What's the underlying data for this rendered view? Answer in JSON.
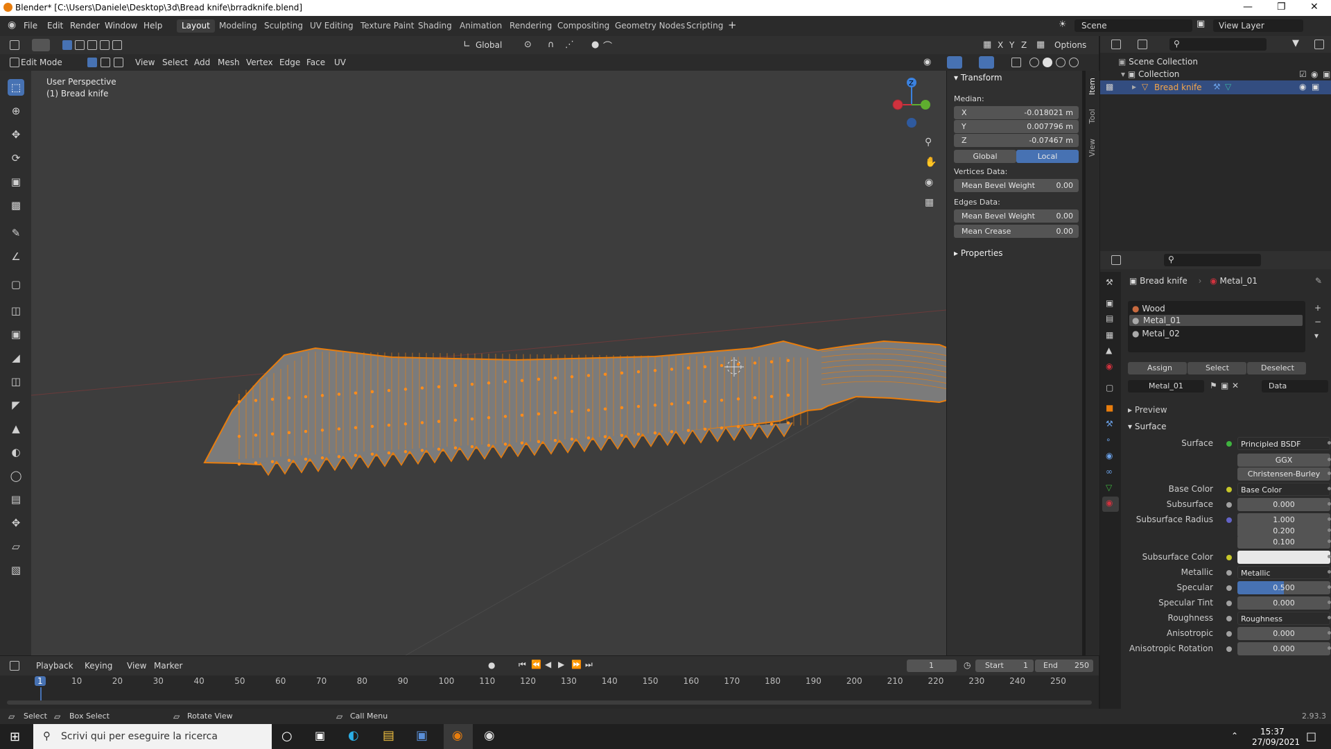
{
  "window": {
    "title": "Blender* [C:\\Users\\Daniele\\Desktop\\3d\\Bread knife\\brradknife.blend]"
  },
  "menu": {
    "items": [
      "File",
      "Edit",
      "Render",
      "Window",
      "Help"
    ]
  },
  "workspaces": [
    "Layout",
    "Modeling",
    "Sculpting",
    "UV Editing",
    "Texture Paint",
    "Shading",
    "Animation",
    "Rendering",
    "Compositing",
    "Geometry Nodes",
    "Scripting"
  ],
  "scene": {
    "label": "Scene",
    "view_layer": "View Layer"
  },
  "toolheader": {
    "transform_orientation": "Global",
    "options": "Options",
    "axes": [
      "X",
      "Y",
      "Z"
    ]
  },
  "viewport_header": {
    "mode": "Edit Mode",
    "menus": [
      "View",
      "Select",
      "Add",
      "Mesh",
      "Vertex",
      "Edge",
      "Face",
      "UV"
    ]
  },
  "viewport": {
    "perspective": "User Perspective",
    "object": "(1) Bread knife",
    "gizmo": {
      "x": "X",
      "y": "Y",
      "z": "Z"
    }
  },
  "npanel": {
    "tabs": [
      "Item",
      "Tool",
      "View"
    ],
    "transform_title": "Transform",
    "median_label": "Median:",
    "x_label": "X",
    "x": "-0.018021 m",
    "y_label": "Y",
    "y": "0.007796 m",
    "z_label": "Z",
    "z": "-0.07467 m",
    "global": "Global",
    "local": "Local",
    "vertices_data": "Vertices Data:",
    "mean_bevel_weight": "Mean Bevel Weight",
    "vbw": "0.00",
    "edges_data": "Edges Data:",
    "ebw": "0.00",
    "mean_crease": "Mean Crease",
    "crease": "0.00",
    "properties": "Properties"
  },
  "outliner": {
    "scene_collection": "Scene Collection",
    "collection": "Collection",
    "object": "Bread knife"
  },
  "properties": {
    "object": "Bread knife",
    "material": "Metal_01",
    "slots": [
      "Wood",
      "Metal_01",
      "Metal_02"
    ],
    "assign": "Assign",
    "select": "Select",
    "deselect": "Deselect",
    "mat_name": "Metal_01",
    "data": "Data",
    "preview": "Preview",
    "surface_section": "Surface",
    "rows": [
      {
        "label": "Surface",
        "value": "Principled BSDF",
        "dot": "#3fb33f",
        "link": true
      },
      {
        "label": "",
        "value": "GGX",
        "dot": "",
        "link": false
      },
      {
        "label": "",
        "value": "Christensen-Burley",
        "dot": "",
        "link": false
      },
      {
        "label": "Base Color",
        "value": "Base Color",
        "dot": "#c7c729",
        "link": true
      },
      {
        "label": "Subsurface",
        "value": "0.000",
        "dot": "#a1a1a1",
        "link": false
      },
      {
        "label": "Subsurface Radius",
        "value": "1.000",
        "dot": "#6363c7",
        "link": false
      },
      {
        "label": "",
        "value": "0.200",
        "dot": "",
        "link": false
      },
      {
        "label": "",
        "value": "0.100",
        "dot": "",
        "link": false
      },
      {
        "label": "Subsurface Color",
        "value": "",
        "dot": "#c7c729",
        "link": false
      },
      {
        "label": "Metallic",
        "value": "Metallic",
        "dot": "#a1a1a1",
        "link": true
      },
      {
        "label": "Specular",
        "value": "0.500",
        "dot": "#a1a1a1",
        "link": false
      },
      {
        "label": "Specular Tint",
        "value": "0.000",
        "dot": "#a1a1a1",
        "link": false
      },
      {
        "label": "Roughness",
        "value": "Roughness",
        "dot": "#a1a1a1",
        "link": true
      },
      {
        "label": "Anisotropic",
        "value": "0.000",
        "dot": "#a1a1a1",
        "link": false
      },
      {
        "label": "Anisotropic Rotation",
        "value": "0.000",
        "dot": "#a1a1a1",
        "link": false
      }
    ],
    "specular_fill": 0.5
  },
  "timeline": {
    "menus": [
      "Playback",
      "Keying",
      "View",
      "Marker"
    ],
    "current_frame": "1",
    "start_label": "Start",
    "start": "1",
    "end_label": "End",
    "end": "250",
    "ticks": [
      "1",
      "10",
      "20",
      "30",
      "40",
      "50",
      "60",
      "70",
      "80",
      "90",
      "100",
      "110",
      "120",
      "130",
      "140",
      "150",
      "160",
      "170",
      "180",
      "190",
      "200",
      "210",
      "220",
      "230",
      "240",
      "250"
    ]
  },
  "status": {
    "select": "Select",
    "box_select": "Box Select",
    "rotate": "Rotate View",
    "call_menu": "Call Menu",
    "version": "2.93.3"
  },
  "taskbar": {
    "search": "Scrivi qui per eseguire la ricerca",
    "time": "15:37",
    "date": "27/09/2021"
  },
  "colors": {
    "accent": "#4772b3",
    "mesh": "#e87d0d",
    "active_object": "#f5a64a"
  }
}
